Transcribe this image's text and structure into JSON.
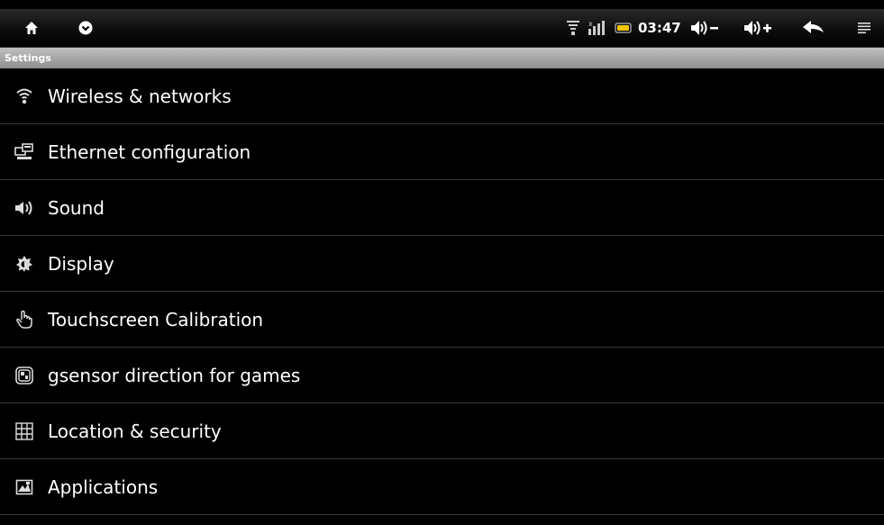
{
  "status_bar": {
    "icons_left": [
      "home-icon",
      "chevron-down-circle-icon"
    ],
    "icons_right": [
      "wifi-icon",
      "signal-icon",
      "battery-icon"
    ],
    "clock": "03:47",
    "buttons": [
      "volume-down-icon",
      "volume-up-icon",
      "back-icon",
      "menu-icon"
    ],
    "accent_battery": "#f5c400"
  },
  "title_bar": {
    "title": "Settings"
  },
  "settings": {
    "items": [
      {
        "label": "Wireless & networks",
        "icon": "wifi-icon"
      },
      {
        "label": "Ethernet configuration",
        "icon": "ethernet-icon"
      },
      {
        "label": "Sound",
        "icon": "speaker-icon"
      },
      {
        "label": "Display",
        "icon": "brightness-icon"
      },
      {
        "label": "Touchscreen Calibration",
        "icon": "hand-pointer-icon"
      },
      {
        "label": "gsensor direction for games",
        "icon": "gsensor-icon"
      },
      {
        "label": "Location & security",
        "icon": "grid-icon"
      },
      {
        "label": "Applications",
        "icon": "applications-icon"
      }
    ]
  }
}
